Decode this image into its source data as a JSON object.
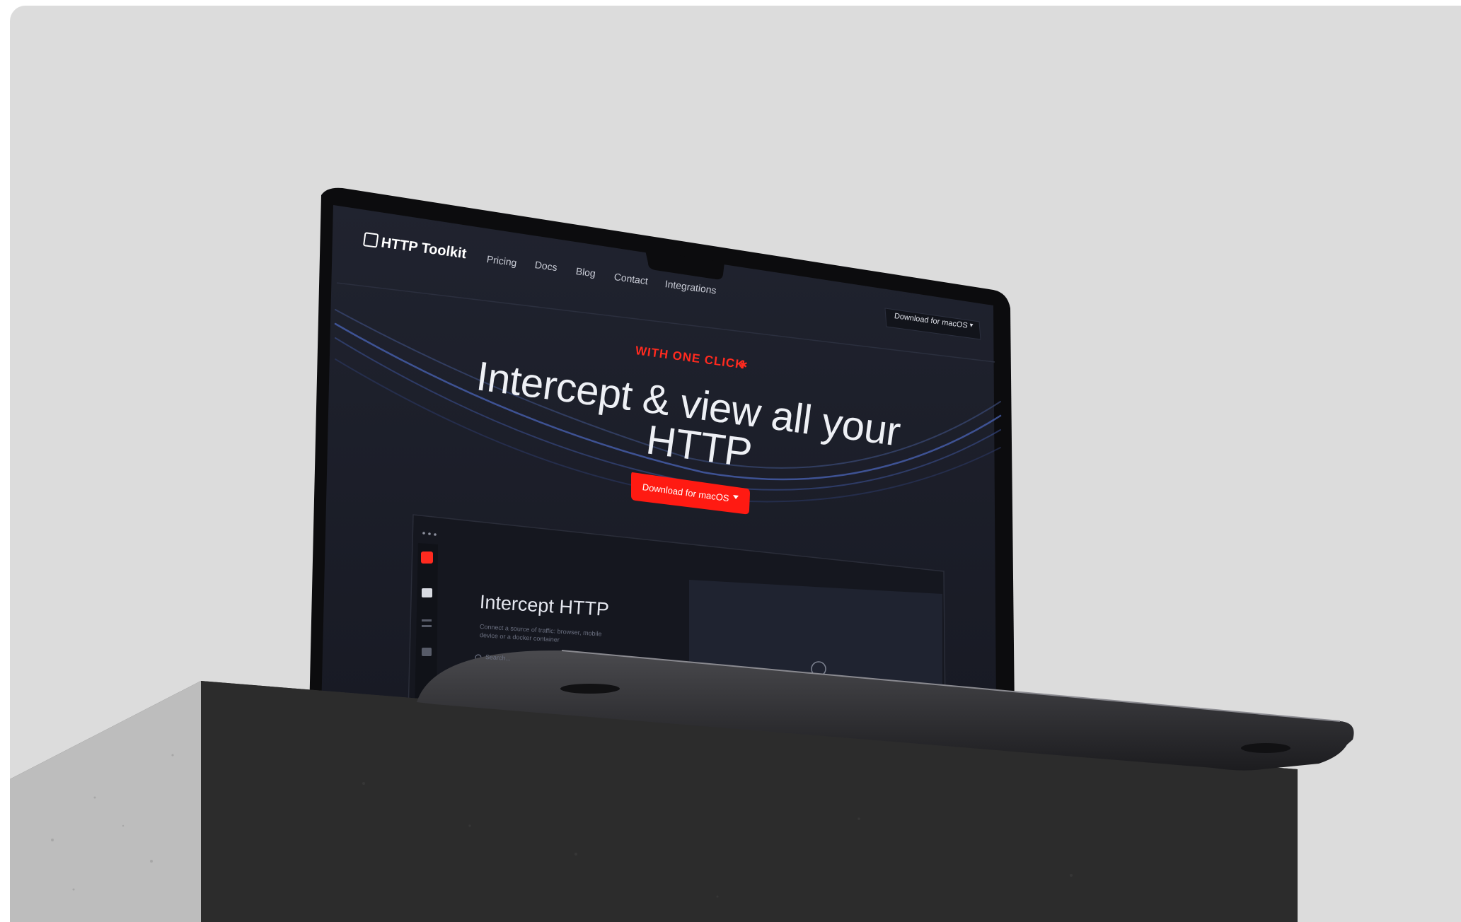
{
  "site": {
    "logo_text": "HTTP Toolkit",
    "nav": [
      "Pricing",
      "Docs",
      "Blog",
      "Contact",
      "Integrations"
    ],
    "header_download": "Download for macOS",
    "eyebrow": "WITH ONE CLICK",
    "hero_line1": "Intercept & view all your",
    "hero_line2": "HTTP",
    "cta_download": "Download for macOS",
    "app_preview": {
      "title": "Intercept HTTP",
      "description_line1": "Connect a source of traffic: browser, mobile",
      "description_line2": "device or a docker container",
      "search_placeholder": "Search..."
    }
  },
  "colors": {
    "background": "#dcdcdc",
    "screen_bg": "#1d2130",
    "accent_red": "#ff2a1f",
    "pedestal": "#2b2b2b"
  },
  "icons": [
    "logo-icon",
    "chevron-down-icon",
    "search-icon",
    "window-dots-icon"
  ]
}
